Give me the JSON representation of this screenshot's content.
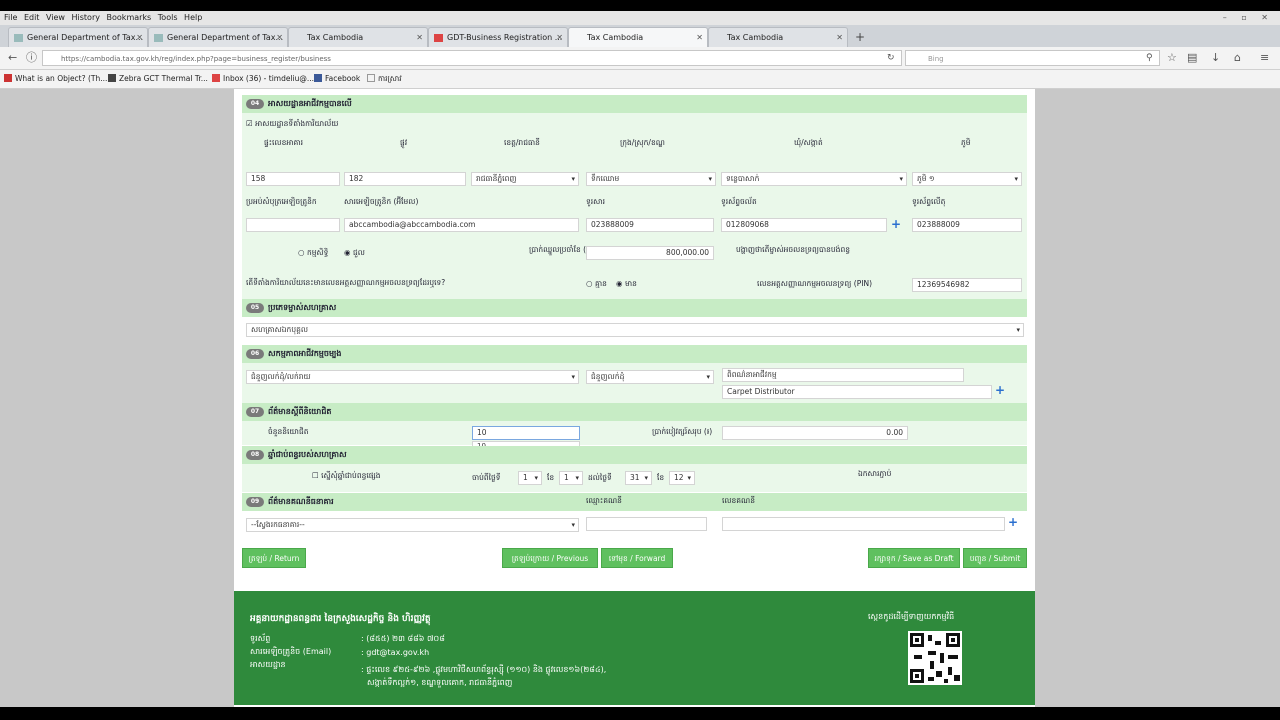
{
  "menu": [
    "File",
    "Edit",
    "View",
    "History",
    "Bookmarks",
    "Tools",
    "Help"
  ],
  "tabs": [
    {
      "label": "General Department of Tax..."
    },
    {
      "label": "General Department of Tax..."
    },
    {
      "label": "Tax Cambodia"
    },
    {
      "label": "GDT-Business Registration ..."
    },
    {
      "label": "Tax Cambodia"
    },
    {
      "label": "Tax Cambodia"
    }
  ],
  "url": "https://cambodia.tax.gov.kh/reg/index.php?page=business_register/business",
  "search_placeholder": "Bing",
  "bookmarks": [
    "What is an Object? (Th...",
    "Zebra GCT Thermal Tr...",
    "Inbox (36) - timdeliu@...",
    "Facebook",
    "ការស្រាវ"
  ],
  "sec04": {
    "num": "04",
    "title": "អាសយដ្ឋានអាជីវកម្មបានលើ",
    "checkbox_label": "អាសយដ្ឋានទីតាំងការិយាល័យ",
    "headers": [
      "ផ្ទះលេខអាគារ",
      "ផ្លូវ",
      "ខេត្ត/រាជធានី",
      "ក្រុង/ស្រុក/ខណ្ឌ",
      "ឃុំ/សង្កាត់",
      "ភូមិ"
    ],
    "house_no": "158",
    "street": "182",
    "province": "រាជធានីភ្នំពេញ",
    "district": "ទឹកឈោម",
    "commune": "ទន្លេបាសាក់",
    "village": "ភូមិ ១",
    "contact_labels": [
      "ប្រអប់សំបុត្រអេឡិចត្រូនិក",
      "សារអេឡិចត្រូនិក (អ៊ីមែល)",
      "ទូរសារ",
      "ទូរស័ព្ទចល័ត",
      "ទូរស័ព្ទលើតុ"
    ],
    "email": "abccambodia@abccambodia.com",
    "fax": "023888009",
    "mobile": "012809068",
    "phone": "023888009",
    "own_label": "កម្មសិទ្ធិ",
    "rent_label": "ជួល",
    "rent_q": "ប្រាក់ឈ្នួលប្រចាំខែ (៛)",
    "rent_value": "800,000.00",
    "tax_q": "បង្ហាញថាតើម្ចាស់អចលនទ្រព្យបានបង់ពន្ធ",
    "question": "តើទីតាំងការិយាល័យនេះមានលេខអត្តសញ្ញាណកម្មអចលនទ្រព្យដែរឬទេ?",
    "no_label": "គ្មាន",
    "yes_label": "មាន",
    "pin_label": "លេខអត្តសញ្ញាណកម្មអចលនទ្រព្យ (PIN)",
    "pin_value": "12369546982"
  },
  "sec05": {
    "num": "05",
    "title": "ប្រភេទម្ចាស់សហគ្រាស",
    "value": "សហគ្រាសឯកបុគ្គល"
  },
  "sec06": {
    "num": "06",
    "title": "សកម្មភាពអាជីវកម្មចម្បង",
    "activity": "ជំនួញលក់ដុំ/លក់រាយ",
    "sub": "ជំនួញលក់ដុំ",
    "desc_label": "ពិពណ៌នាអាជីវកម្ម",
    "desc_value": "Carpet Distributor"
  },
  "sec07": {
    "num": "07",
    "title": "ព័ត៌មានស្ដីពីនិយោជិត",
    "emp_label": "ចំនួននិយោជិត",
    "emp_value": "10",
    "emp_suggest": "10",
    "salary_label": "ប្រាក់បៀវត្សរ៍សរុប (៛)",
    "salary_value": "0.00"
  },
  "sec08": {
    "num": "08",
    "title": "ឆ្នាំជាប់ពន្ធរបស់សហគ្រាស",
    "other_label": "ស្នើសុំឆ្នាំជាប់ពន្ធផ្សេង",
    "start_label": "ចាប់ពីថ្ងៃទី",
    "day1": "1",
    "month_label": "ខែ",
    "month1": "1",
    "end_label": "ដល់ថ្ងៃទី",
    "day2": "31",
    "month2": "12",
    "attach_label": "ឯកសារភ្ជាប់"
  },
  "sec09": {
    "num": "09",
    "title": "ព័ត៌មានគណនីធនាគារ",
    "bank_placeholder": "--ស្វែងរកធនាគារ--",
    "acc_name_label": "ឈ្មោះគណនី",
    "acc_no_label": "លេខគណនី"
  },
  "buttons": {
    "return": "ត្រឡប់ / Return",
    "previous": "ត្រឡប់ក្រោយ / Previous",
    "forward": "ទៅមុខ / Forward",
    "draft": "រក្សាទុក / Save as Draft",
    "submit": "បញ្ជូន / Submit"
  },
  "footer": {
    "org": "អគ្គនាយកដ្ឋានពន្ធដារ នៃក្រសួងសេដ្ឋកិច្ច និង ហិរញ្ញវត្ថុ",
    "qr_title": "ស្កេនកូដដើម្បីទាញយកកម្មវិធី",
    "phone_label": "ទូរស័ព្ទ",
    "phone": ": (៨៥៥) ២៣ ៨៨៦ ៧០៨",
    "email_label": "សារអេឡិចត្រូនិច (Email)",
    "email": ": gdt@tax.gov.kh",
    "addr_label": "អាសយដ្ឋាន",
    "addr1": ": ផ្ទះលេខ ៩២៥-៩២៦ ,ផ្លូវមហាវិថីសហព័ន្ធរុស្ស៊ី (១១០) និង ផ្លូវលេខ១៦(២៨៤),",
    "addr2": "សង្កាត់ទឹកល្អក់១, ខណ្ឌទួលគោក, រាជធានីភ្នំពេញ"
  }
}
